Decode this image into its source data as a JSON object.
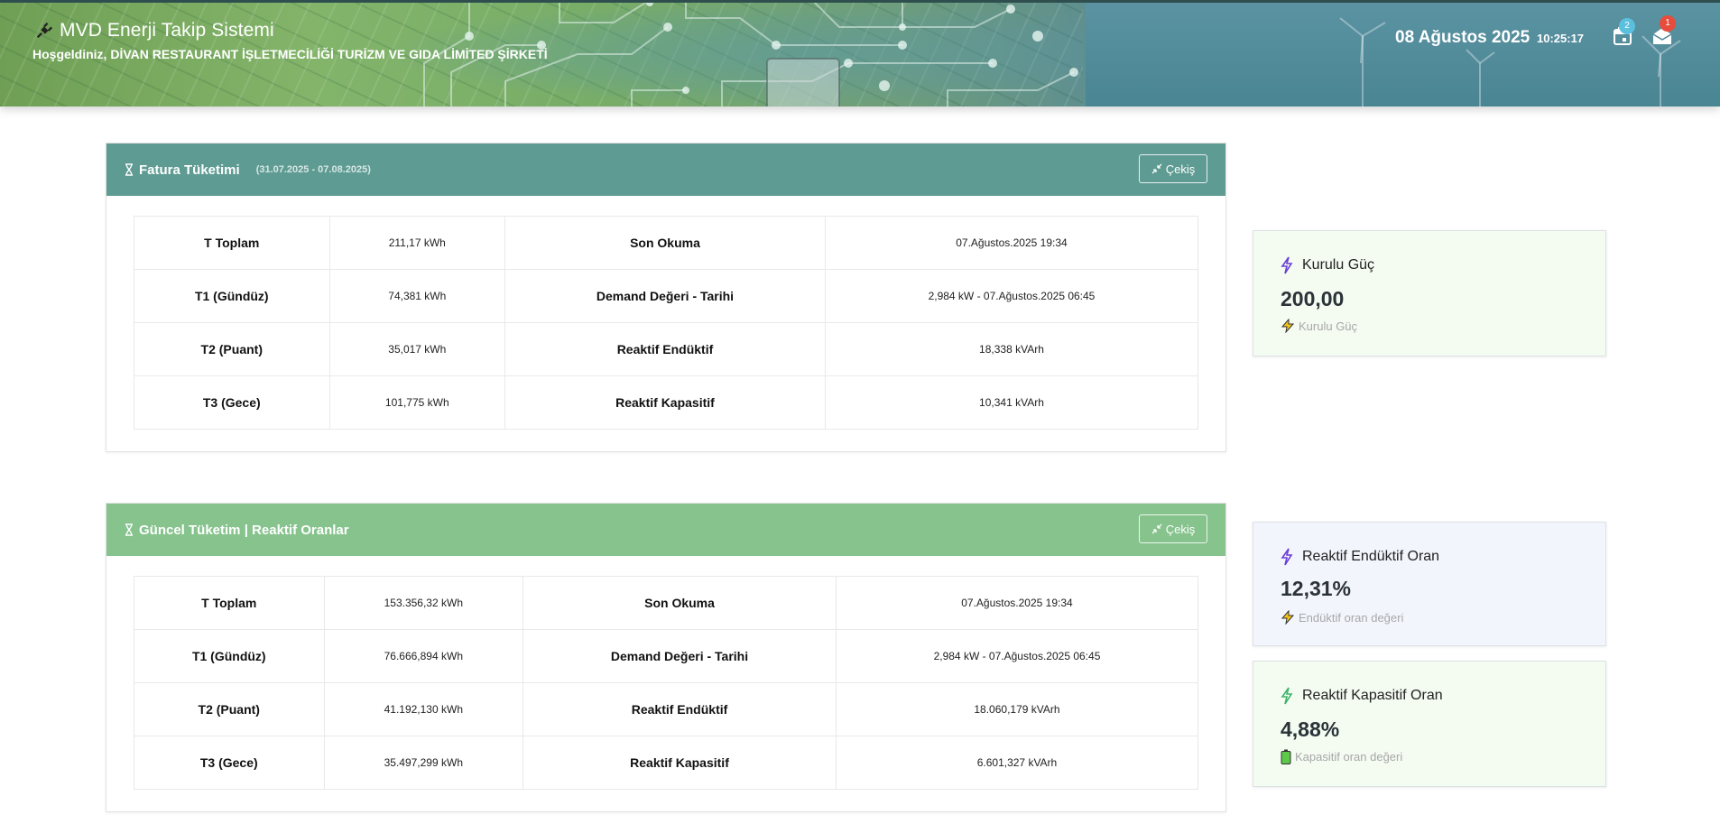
{
  "header": {
    "app_title": "MVD Enerji Takip Sistemi",
    "welcome": "Hoşgeldiniz, DİVAN RESTAURANT İŞLETMECİLİĞİ TURİZM VE GIDA LİMİTED ŞİRKETİ",
    "date": "08 Ağustos 2025",
    "time": "10:25:17",
    "calendar_badge": "2",
    "mail_badge": "1",
    "calendar_badge_color": "#5bc0de",
    "mail_badge_color": "#e74c3c"
  },
  "invoice_card": {
    "title": "Fatura Tüketimi",
    "period": "(31.07.2025 - 07.08.2025)",
    "button": "Çekiş",
    "header_color": "#5e9b92",
    "rows": [
      {
        "label": "T Toplam",
        "value": "211,17 kWh",
        "label2": "Son Okuma",
        "value2": "07.Ağustos.2025 19:34"
      },
      {
        "label": "T1 (Gündüz)",
        "value": "74,381 kWh",
        "label2": "Demand Değeri - Tarihi",
        "value2": "2,984 kW - 07.Ağustos.2025 06:45"
      },
      {
        "label": "T2 (Puant)",
        "value": "35,017 kWh",
        "label2": "Reaktif Endüktif",
        "value2": "18,338 kVArh"
      },
      {
        "label": "T3 (Gece)",
        "value": "101,775 kWh",
        "label2": "Reaktif Kapasitif",
        "value2": "10,341 kVArh"
      }
    ]
  },
  "current_card": {
    "title": "Güncel Tüketim | Reaktif Oranlar",
    "button": "Çekiş",
    "header_color": "#86c38d",
    "rows": [
      {
        "label": "T Toplam",
        "value": "153.356,32 kWh",
        "label2": "Son Okuma",
        "value2": "07.Ağustos.2025 19:34"
      },
      {
        "label": "T1 (Gündüz)",
        "value": "76.666,894 kWh",
        "label2": "Demand Değeri - Tarihi",
        "value2": "2,984 kW - 07.Ağustos.2025 06:45"
      },
      {
        "label": "T2 (Puant)",
        "value": "41.192,130 kWh",
        "label2": "Reaktif Endüktif",
        "value2": "18.060,179 kVArh"
      },
      {
        "label": "T3 (Gece)",
        "value": "35.497,299 kWh",
        "label2": "Reaktif Kapasitif",
        "value2": "6.601,327 kVArh"
      }
    ]
  },
  "stats": {
    "installed_power": {
      "title": "Kurulu Güç",
      "value": "200,00",
      "note": "Kurulu Güç",
      "bg": "#f4fcf2"
    },
    "inductive_ratio": {
      "title": "Reaktif Endüktif Oran",
      "value": "12,31%",
      "note": "Endüktif oran değeri",
      "bg": "#f3f5fd"
    },
    "capacitive_ratio": {
      "title": "Reaktif Kapasitif Oran",
      "value": "4,88%",
      "note": "Kapasitif oran değeri",
      "bg": "#f4fcf2"
    }
  }
}
